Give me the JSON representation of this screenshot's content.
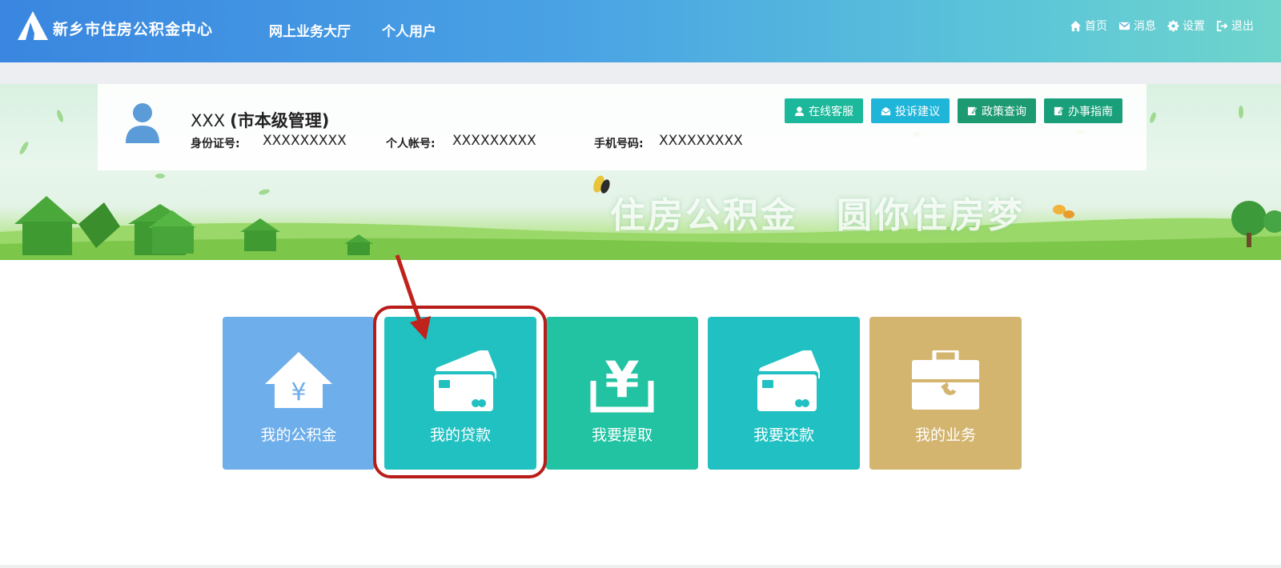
{
  "header": {
    "site_title": "新乡市住房公积金中心",
    "nav": [
      "网上业务大厅",
      "个人用户"
    ],
    "links": [
      {
        "label": "首页",
        "icon": "home-icon"
      },
      {
        "label": "消息",
        "icon": "envelope-icon"
      },
      {
        "label": "设置",
        "icon": "gear-icon"
      },
      {
        "label": "退出",
        "icon": "logout-icon"
      }
    ]
  },
  "user": {
    "name": "XXX",
    "role": "(市本级管理)",
    "id_label": "身份证号:",
    "id_value": "XXXXXXXXX",
    "account_label": "个人帐号:",
    "account_value": "XXXXXXXXX",
    "phone_label": "手机号码:",
    "phone_value": "XXXXXXXXX"
  },
  "actions": [
    {
      "label": "在线客服",
      "icon": "service-icon",
      "color": "#1cb89b"
    },
    {
      "label": "投诉建议",
      "icon": "envelope-open-icon",
      "color": "#1fb5d9"
    },
    {
      "label": "政策查询",
      "icon": "edit-icon",
      "color": "#1d9a72"
    },
    {
      "label": "办事指南",
      "icon": "edit-icon",
      "color": "#19a07a"
    }
  ],
  "banner": {
    "slogan_left": "住房公积金",
    "slogan_right": "圆你住房梦"
  },
  "tiles": [
    {
      "label": "我的公积金",
      "icon": "house-yen-icon",
      "color": "#6eaeea"
    },
    {
      "label": "我的贷款",
      "icon": "cards-icon",
      "color": "#21c1c2",
      "highlighted": true
    },
    {
      "label": "我要提取",
      "icon": "yen-tray-icon",
      "color": "#21c3a2"
    },
    {
      "label": "我要还款",
      "icon": "cards-icon",
      "color": "#21c1c3"
    },
    {
      "label": "我的业务",
      "icon": "toolbox-icon",
      "color": "#d4b570"
    }
  ]
}
